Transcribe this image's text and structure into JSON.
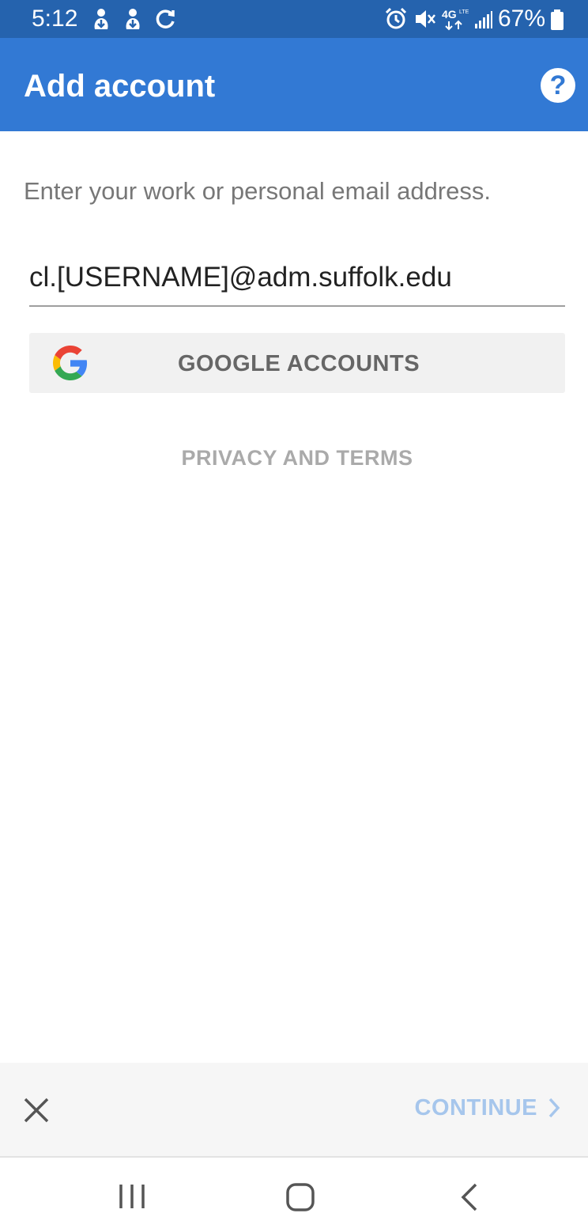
{
  "status_bar": {
    "time": "5:12",
    "battery_percent": "67%",
    "icons": [
      "download-icon",
      "download-icon",
      "sync-icon",
      "alarm-icon",
      "mute-icon",
      "4g-lte-icon",
      "signal-icon",
      "battery-icon"
    ],
    "background_color": "#2563ae"
  },
  "app_bar": {
    "title": "Add account",
    "help_icon": "help-icon",
    "background_color": "#3279d4"
  },
  "form": {
    "instructions": "Enter your work or personal email address.",
    "email_value": "cl.[USERNAME]@adm.suffolk.edu",
    "google_button_label": "GOOGLE ACCOUNTS",
    "google_icon": "google-logo-icon",
    "privacy_link": "PRIVACY AND TERMS"
  },
  "bottom_bar": {
    "close_icon": "close-icon",
    "continue_label": "CONTINUE",
    "continue_icon": "chevron-right-icon",
    "continue_color": "#a6c6ec"
  },
  "nav_bar": {
    "icons": [
      "recents-icon",
      "home-icon",
      "back-icon"
    ]
  }
}
